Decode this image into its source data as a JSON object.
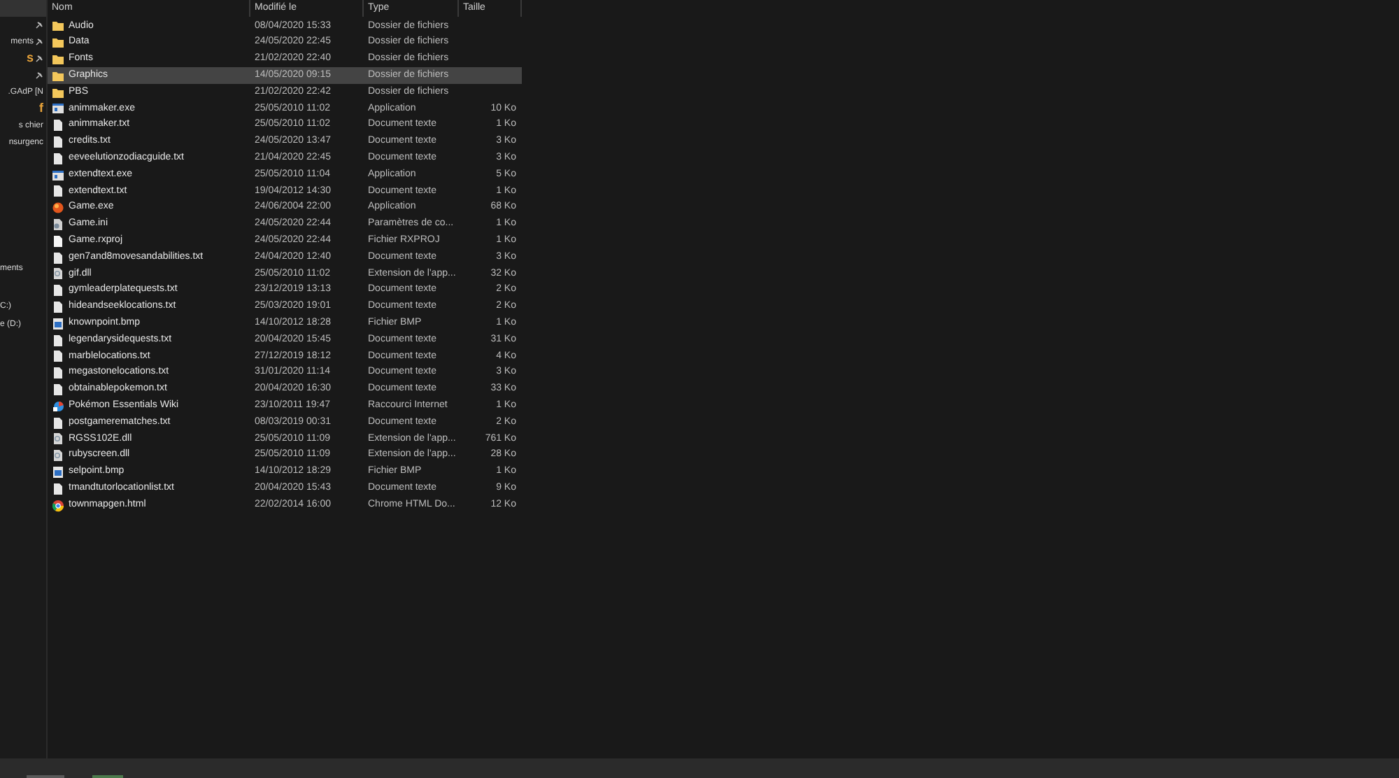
{
  "sidebar": {
    "items": [
      {
        "pinned": false,
        "selected": true
      },
      {
        "pinned": true,
        "selected": false
      },
      {
        "label": "ments",
        "pinned": true,
        "selected": false
      },
      {
        "label": "s",
        "pinned": true,
        "selected": false,
        "color": "#e8a33a"
      },
      {
        "pinned": true,
        "selected": false
      },
      {
        "label": ".GAdP [N",
        "pinned": false,
        "selected": false
      },
      {
        "label": "f",
        "pinned": false,
        "selected": false,
        "color": "#e8a33a"
      },
      {
        "label": "s chier",
        "pinned": false,
        "selected": false
      },
      {
        "label": "nsurgenc",
        "pinned": false,
        "selected": false
      }
    ],
    "lower_items": [
      "ments",
      "C:)",
      "e (D:)"
    ]
  },
  "table": {
    "columns": [
      "Nom",
      "Modifié le",
      "Type",
      "Taille"
    ],
    "rows": [
      {
        "name": "Audio",
        "modified": "08/04/2020 15:33",
        "type": "Dossier de fichiers",
        "size": "",
        "kind": "folder",
        "selected": false
      },
      {
        "name": "Data",
        "modified": "24/05/2020 22:45",
        "type": "Dossier de fichiers",
        "size": "",
        "kind": "folder",
        "selected": false
      },
      {
        "name": "Fonts",
        "modified": "21/02/2020 22:40",
        "type": "Dossier de fichiers",
        "size": "",
        "kind": "folder",
        "selected": false
      },
      {
        "name": "Graphics",
        "modified": "14/05/2020 09:15",
        "type": "Dossier de fichiers",
        "size": "",
        "kind": "folder",
        "selected": true
      },
      {
        "name": "PBS",
        "modified": "21/02/2020 22:42",
        "type": "Dossier de fichiers",
        "size": "",
        "kind": "folder",
        "selected": false
      },
      {
        "name": "animmaker.exe",
        "modified": "25/05/2010 11:02",
        "type": "Application",
        "size": "10 Ko",
        "kind": "app",
        "selected": false
      },
      {
        "name": "animmaker.txt",
        "modified": "25/05/2010 11:02",
        "type": "Document texte",
        "size": "1 Ko",
        "kind": "text",
        "selected": false
      },
      {
        "name": "credits.txt",
        "modified": "24/05/2020 13:47",
        "type": "Document texte",
        "size": "3 Ko",
        "kind": "text",
        "selected": false
      },
      {
        "name": "eeveelutionzodiacguide.txt",
        "modified": "21/04/2020 22:45",
        "type": "Document texte",
        "size": "3 Ko",
        "kind": "text",
        "selected": false
      },
      {
        "name": "extendtext.exe",
        "modified": "25/05/2010 11:04",
        "type": "Application",
        "size": "5 Ko",
        "kind": "app",
        "selected": false
      },
      {
        "name": "extendtext.txt",
        "modified": "19/04/2012 14:30",
        "type": "Document texte",
        "size": "1 Ko",
        "kind": "text",
        "selected": false
      },
      {
        "name": "Game.exe",
        "modified": "24/06/2004 22:00",
        "type": "Application",
        "size": "68 Ko",
        "kind": "orb",
        "selected": false
      },
      {
        "name": "Game.ini",
        "modified": "24/05/2020 22:44",
        "type": "Paramètres de co...",
        "size": "1 Ko",
        "kind": "settings",
        "selected": false
      },
      {
        "name": "Game.rxproj",
        "modified": "24/05/2020 22:44",
        "type": "Fichier RXPROJ",
        "size": "1 Ko",
        "kind": "blank",
        "selected": false
      },
      {
        "name": "gen7and8movesandabilities.txt",
        "modified": "24/04/2020 12:40",
        "type": "Document texte",
        "size": "3 Ko",
        "kind": "text",
        "selected": false
      },
      {
        "name": "gif.dll",
        "modified": "25/05/2010 11:02",
        "type": "Extension de l'app...",
        "size": "32 Ko",
        "kind": "library",
        "selected": false
      },
      {
        "name": "gymleaderplatequests.txt",
        "modified": "23/12/2019 13:13",
        "type": "Document texte",
        "size": "2 Ko",
        "kind": "text",
        "selected": false
      },
      {
        "name": "hideandseeklocations.txt",
        "modified": "25/03/2020 19:01",
        "type": "Document texte",
        "size": "2 Ko",
        "kind": "text",
        "selected": false
      },
      {
        "name": "knownpoint.bmp",
        "modified": "14/10/2012 18:28",
        "type": "Fichier BMP",
        "size": "1 Ko",
        "kind": "image",
        "selected": false
      },
      {
        "name": "legendarysidequests.txt",
        "modified": "20/04/2020 15:45",
        "type": "Document texte",
        "size": "31 Ko",
        "kind": "text",
        "selected": false
      },
      {
        "name": "marblelocations.txt",
        "modified": "27/12/2019 18:12",
        "type": "Document texte",
        "size": "4 Ko",
        "kind": "text",
        "selected": false
      },
      {
        "name": "megastonelocations.txt",
        "modified": "31/01/2020 11:14",
        "type": "Document texte",
        "size": "3 Ko",
        "kind": "text",
        "selected": false
      },
      {
        "name": "obtainablepokemon.txt",
        "modified": "20/04/2020 16:30",
        "type": "Document texte",
        "size": "33 Ko",
        "kind": "text",
        "selected": false
      },
      {
        "name": "Pokémon Essentials Wiki",
        "modified": "23/10/2011 19:47",
        "type": "Raccourci Internet",
        "size": "1 Ko",
        "kind": "shortcut",
        "selected": false
      },
      {
        "name": "postgamerematches.txt",
        "modified": "08/03/2019 00:31",
        "type": "Document texte",
        "size": "2 Ko",
        "kind": "text",
        "selected": false
      },
      {
        "name": "RGSS102E.dll",
        "modified": "25/05/2010 11:09",
        "type": "Extension de l'app...",
        "size": "761 Ko",
        "kind": "library",
        "selected": false
      },
      {
        "name": "rubyscreen.dll",
        "modified": "25/05/2010 11:09",
        "type": "Extension de l'app...",
        "size": "28 Ko",
        "kind": "library",
        "selected": false
      },
      {
        "name": "selpoint.bmp",
        "modified": "14/10/2012 18:29",
        "type": "Fichier BMP",
        "size": "1 Ko",
        "kind": "image",
        "selected": false
      },
      {
        "name": "tmandtutorlocationlist.txt",
        "modified": "20/04/2020 15:43",
        "type": "Document texte",
        "size": "9 Ko",
        "kind": "text",
        "selected": false
      },
      {
        "name": "townmapgen.html",
        "modified": "22/02/2014 16:00",
        "type": "Chrome HTML Do...",
        "size": "12 Ko",
        "kind": "browser",
        "selected": false
      }
    ]
  }
}
